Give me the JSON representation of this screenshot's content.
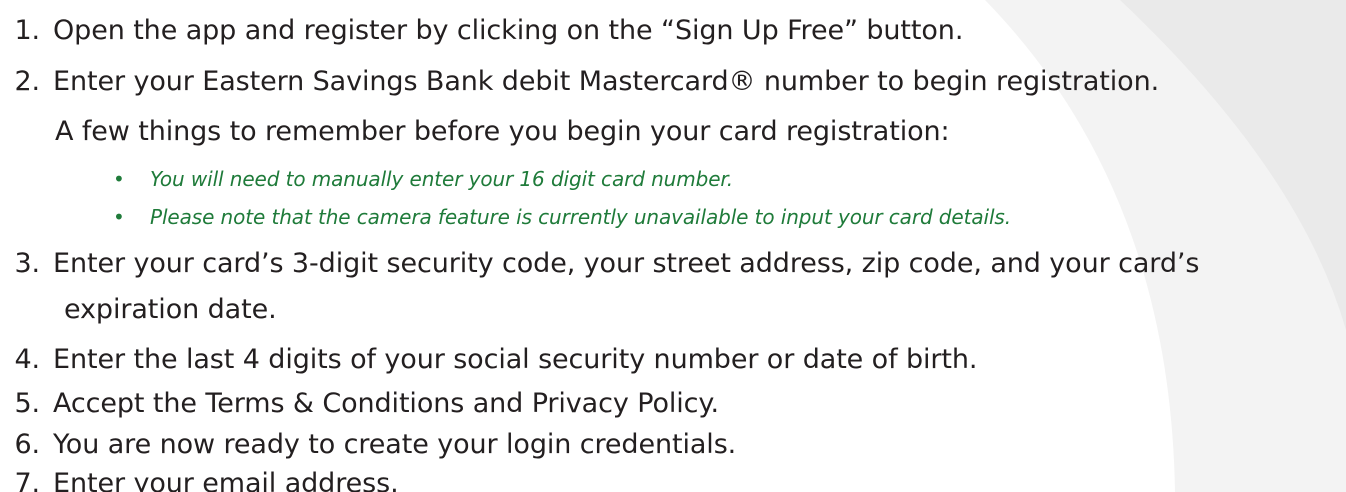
{
  "steps": [
    {
      "num": "1.",
      "text": "Open the app and register by clicking on the “Sign Up Free” button."
    },
    {
      "num": "2.",
      "text": "Enter your Eastern Savings Bank debit Mastercard® number to begin registration."
    },
    {
      "num": "3.",
      "text": "Enter your card’s 3-digit security code, your street address, zip code, and your card’s"
    },
    {
      "num": "4.",
      "text": "Enter the last 4 digits of your social security number or date of birth."
    },
    {
      "num": "5.",
      "text": "Accept the Terms & Conditions and Privacy Policy."
    },
    {
      "num": "6.",
      "text": "You are now ready to create your login credentials."
    },
    {
      "num": "7.",
      "text": "Enter your email address."
    }
  ],
  "step2_note": "A few things to remember before you begin your card registration:",
  "step3_continued": "expiration date.",
  "bullets": [
    {
      "symbol": "•",
      "text": "You will need to manually enter your 16 digit card number."
    },
    {
      "symbol": "•",
      "text": "Please note that the camera feature is currently unavailable to input your card details."
    }
  ],
  "colors": {
    "body_text": "#231f20",
    "bullet_text": "#1f7b3a",
    "background_arc": "#efefef"
  }
}
